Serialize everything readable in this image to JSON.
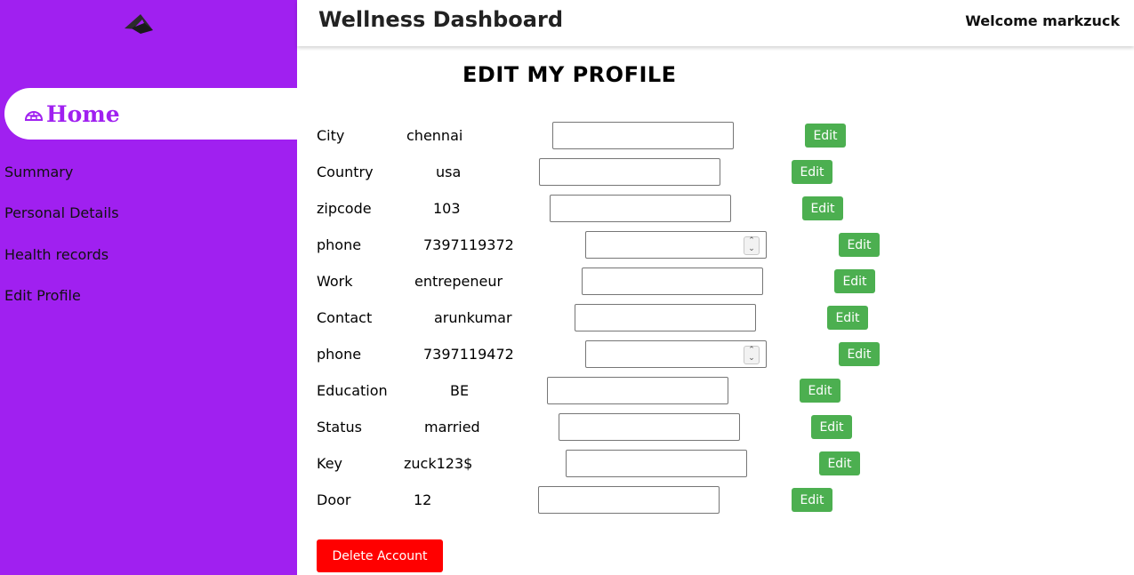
{
  "sidebar": {
    "logo_icon": "paper-plane-logo",
    "home": {
      "icon": "igloo-icon",
      "label": "Home"
    },
    "items": [
      {
        "label": "Summary"
      },
      {
        "label": "Personal Details"
      },
      {
        "label": "Health records"
      },
      {
        "label": "Edit Profile"
      }
    ]
  },
  "header": {
    "title": "Wellness Dashboard",
    "welcome": "Welcome markzuck"
  },
  "main": {
    "title": "EDIT MY PROFILE",
    "fields": [
      {
        "label": "City",
        "value": "chennai",
        "edit_label": "Edit",
        "type": "text",
        "input_value": ""
      },
      {
        "label": "Country",
        "value": "usa",
        "edit_label": "Edit",
        "type": "text",
        "input_value": ""
      },
      {
        "label": "zipcode",
        "value": "103",
        "edit_label": "Edit",
        "type": "text",
        "input_value": ""
      },
      {
        "label": "phone",
        "value": "7397119372",
        "edit_label": "Edit",
        "type": "number",
        "input_value": ""
      },
      {
        "label": "Work",
        "value": "entrepeneur",
        "edit_label": "Edit",
        "type": "text",
        "input_value": ""
      },
      {
        "label": "Contact",
        "value": "arunkumar",
        "edit_label": "Edit",
        "type": "text",
        "input_value": ""
      },
      {
        "label": "phone",
        "value": "7397119472",
        "edit_label": "Edit",
        "type": "number",
        "input_value": ""
      },
      {
        "label": "Education",
        "value": "BE",
        "edit_label": "Edit",
        "type": "text",
        "input_value": ""
      },
      {
        "label": "Status",
        "value": "married",
        "edit_label": "Edit",
        "type": "text",
        "input_value": ""
      },
      {
        "label": "Key",
        "value": "zuck123$",
        "edit_label": "Edit",
        "type": "text",
        "input_value": ""
      },
      {
        "label": "Door",
        "value": "12",
        "edit_label": "Edit",
        "type": "text",
        "input_value": ""
      }
    ],
    "delete_label": "Delete Account"
  },
  "colors": {
    "sidebar_bg": "#a020f0",
    "edit_button": "#4caf50",
    "delete_button": "#ff0000"
  }
}
